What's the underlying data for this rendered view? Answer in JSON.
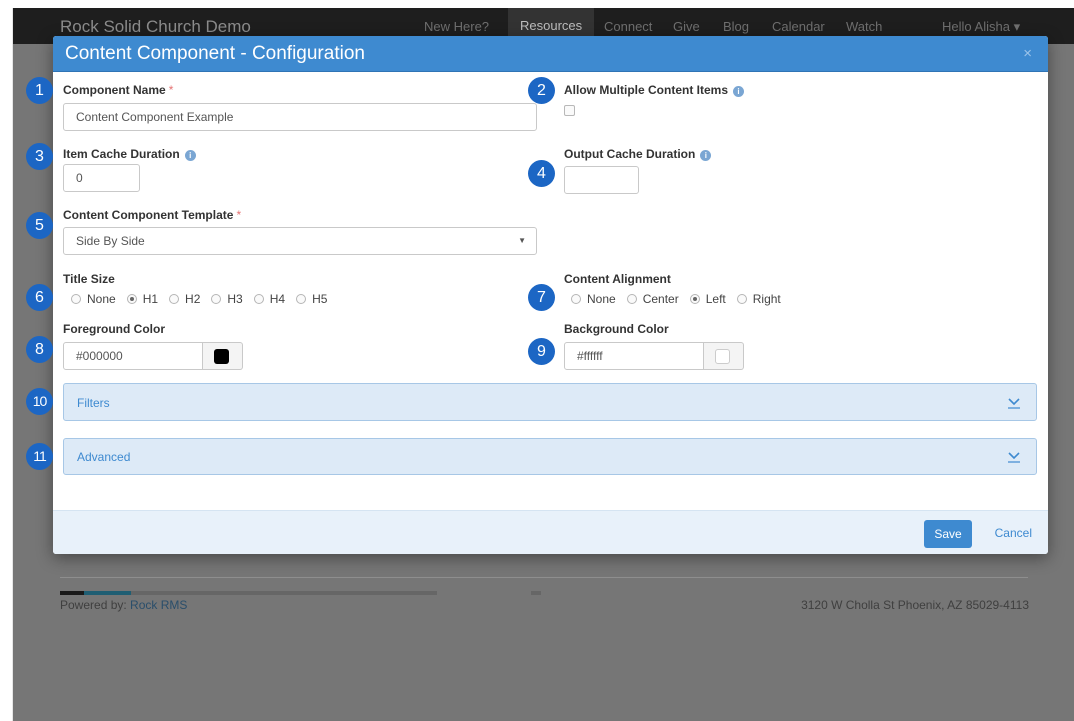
{
  "background": {
    "brand": "Rock Solid Church Demo",
    "nav": [
      "New Here?",
      "Resources",
      "Connect",
      "Give",
      "Blog",
      "Calendar",
      "Watch"
    ],
    "user_menu": "Hello Alisha",
    "footer": {
      "powered_by": "Powered by:",
      "powered_by_link": "Rock RMS",
      "address": "3120 W Cholla St Phoenix, AZ 85029-4113"
    }
  },
  "modal": {
    "title": "Content Component - Configuration",
    "close_glyph": "×",
    "fields": {
      "component_name": {
        "label": "Component Name",
        "value": "Content Component Example"
      },
      "allow_multiple": {
        "label": "Allow Multiple Content Items"
      },
      "item_cache": {
        "label": "Item Cache Duration",
        "value": "0"
      },
      "output_cache": {
        "label": "Output Cache Duration",
        "value": ""
      },
      "template": {
        "label": "Content Component Template",
        "value": "Side By Side"
      },
      "title_size": {
        "label": "Title Size",
        "options": [
          "None",
          "H1",
          "H2",
          "H3",
          "H4",
          "H5"
        ],
        "selected": "H1"
      },
      "content_alignment": {
        "label": "Content Alignment",
        "options": [
          "None",
          "Center",
          "Left",
          "Right"
        ],
        "selected": "Left"
      },
      "foreground_color": {
        "label": "Foreground Color",
        "value": "#000000"
      },
      "background_color": {
        "label": "Background Color",
        "value": "#ffffff"
      }
    },
    "panels": {
      "filters": "Filters",
      "advanced": "Advanced"
    },
    "footer": {
      "save": "Save",
      "cancel": "Cancel"
    }
  },
  "callouts": [
    "1",
    "2",
    "3",
    "4",
    "5",
    "6",
    "7",
    "8",
    "9",
    "10",
    "11"
  ],
  "colors": {
    "primary": "#3e8ad0",
    "callout": "#1c66c4",
    "panel_bg": "#ddeaf7",
    "required": "#e57373"
  }
}
